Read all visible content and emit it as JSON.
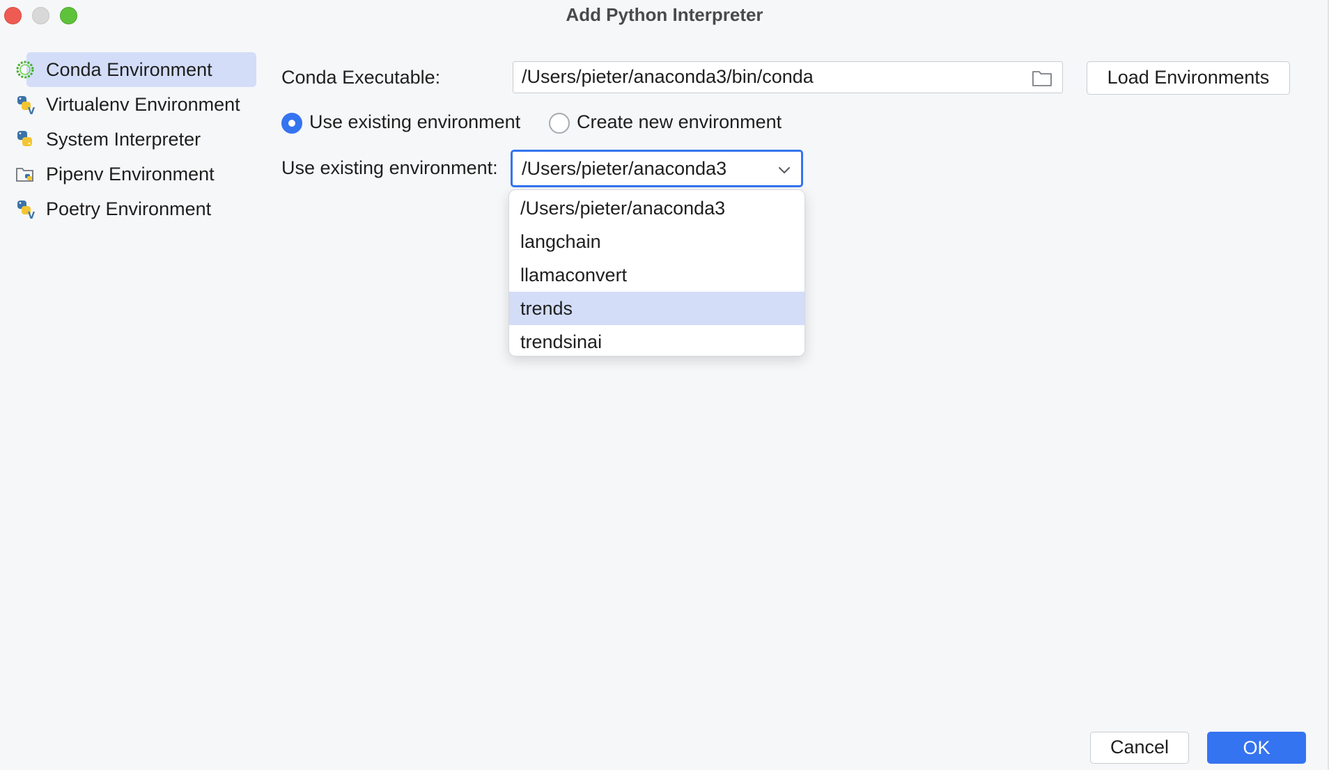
{
  "window": {
    "title": "Add Python Interpreter"
  },
  "sidebar": {
    "items": [
      {
        "label": "Conda Environment",
        "icon": "conda-icon",
        "selected": true
      },
      {
        "label": "Virtualenv Environment",
        "icon": "python-virtualenv-icon",
        "selected": false
      },
      {
        "label": "System Interpreter",
        "icon": "python-icon",
        "selected": false
      },
      {
        "label": "Pipenv Environment",
        "icon": "pipenv-folder-icon",
        "selected": false
      },
      {
        "label": "Poetry Environment",
        "icon": "python-poetry-icon",
        "selected": false
      }
    ]
  },
  "form": {
    "conda_executable_label": "Conda Executable:",
    "conda_executable_value": "/Users/pieter/anaconda3/bin/conda",
    "load_environments_label": "Load Environments",
    "radio_existing_label": "Use existing environment",
    "radio_new_label": "Create new environment",
    "existing_env_label": "Use existing environment:",
    "existing_env_value": "/Users/pieter/anaconda3"
  },
  "dropdown": {
    "options": [
      "/Users/pieter/anaconda3",
      "langchain",
      "llamaconvert",
      "trends",
      "trendsinai"
    ],
    "highlighted": "trends"
  },
  "footer": {
    "cancel_label": "Cancel",
    "ok_label": "OK"
  },
  "colors": {
    "accent": "#3574f0",
    "selection": "#d3ddf8",
    "background": "#f6f7f9"
  }
}
